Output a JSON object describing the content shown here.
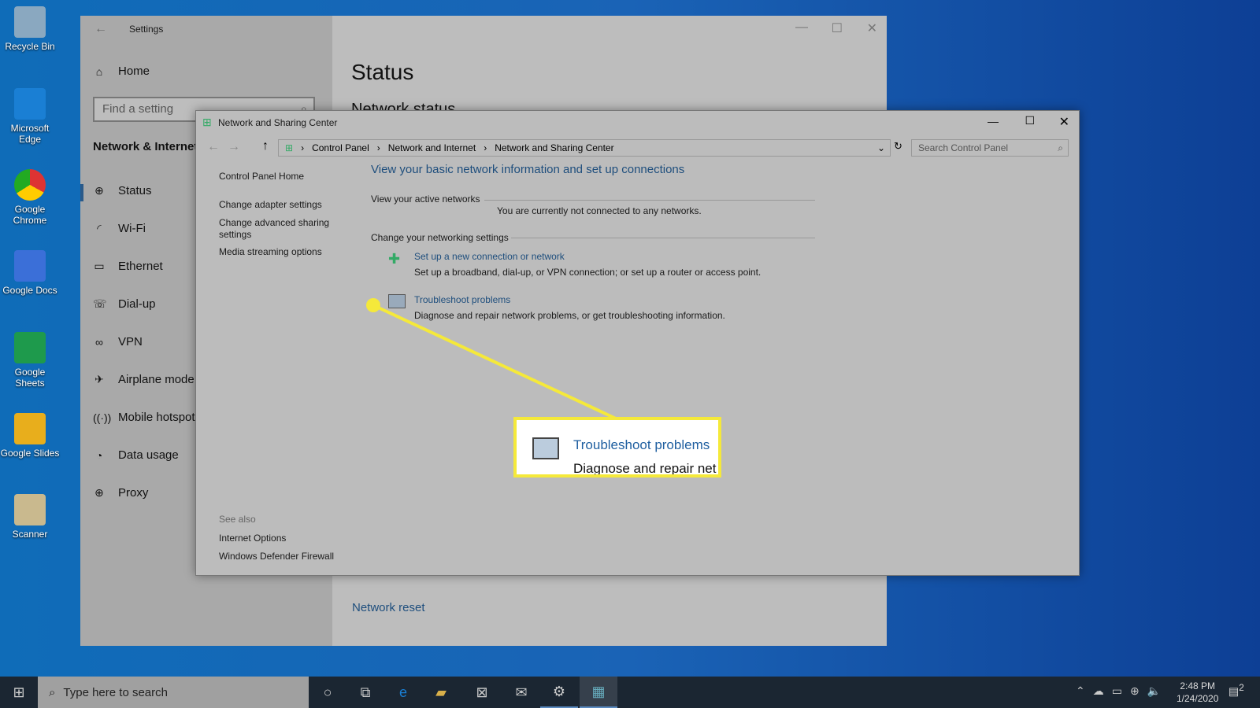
{
  "desktop": {
    "icons": [
      "Recycle Bin",
      "Microsoft Edge",
      "Google Chrome",
      "Google Docs",
      "Google Sheets",
      "Google Slides",
      "Scanner"
    ]
  },
  "settings": {
    "title": "Settings",
    "home": "Home",
    "search_placeholder": "Find a setting",
    "section": "Network & Internet",
    "items": [
      {
        "label": "Status",
        "icon": "globe-icon"
      },
      {
        "label": "Wi-Fi",
        "icon": "wifi-icon"
      },
      {
        "label": "Ethernet",
        "icon": "ethernet-icon"
      },
      {
        "label": "Dial-up",
        "icon": "dialup-icon"
      },
      {
        "label": "VPN",
        "icon": "vpn-icon"
      },
      {
        "label": "Airplane mode",
        "icon": "airplane-icon"
      },
      {
        "label": "Mobile hotspot",
        "icon": "hotspot-icon"
      },
      {
        "label": "Data usage",
        "icon": "data-usage-icon"
      },
      {
        "label": "Proxy",
        "icon": "globe-icon"
      }
    ],
    "page_title": "Status",
    "subtitle": "Network status",
    "network_reset": "Network reset"
  },
  "nsc": {
    "title": "Network and Sharing Center",
    "breadcrumb": [
      "Control Panel",
      "Network and Internet",
      "Network and Sharing Center"
    ],
    "search_placeholder": "Search Control Panel",
    "sidebar": [
      "Control Panel Home",
      "Change adapter settings",
      "Change advanced sharing settings",
      "Media streaming options"
    ],
    "see_also": "See also",
    "see_also_links": [
      "Internet Options",
      "Windows Defender Firewall"
    ],
    "heading": "View your basic network information and set up connections",
    "active_networks": "View your active networks",
    "not_connected": "You are currently not connected to any networks.",
    "change_settings": "Change your networking settings",
    "tasks": [
      {
        "title": "Set up a new connection or network",
        "desc": "Set up a broadband, dial-up, or VPN connection; or set up a router or access point."
      },
      {
        "title": "Troubleshoot problems",
        "desc": "Diagnose and repair network problems, or get troubleshooting information."
      }
    ]
  },
  "callout": {
    "title": "Troubleshoot problems",
    "desc": "Diagnose and repair net",
    "color": "#f5e93a"
  },
  "taskbar": {
    "search_placeholder": "Type here to search",
    "time": "2:48 PM",
    "date": "1/24/2020",
    "notifications": "2"
  }
}
